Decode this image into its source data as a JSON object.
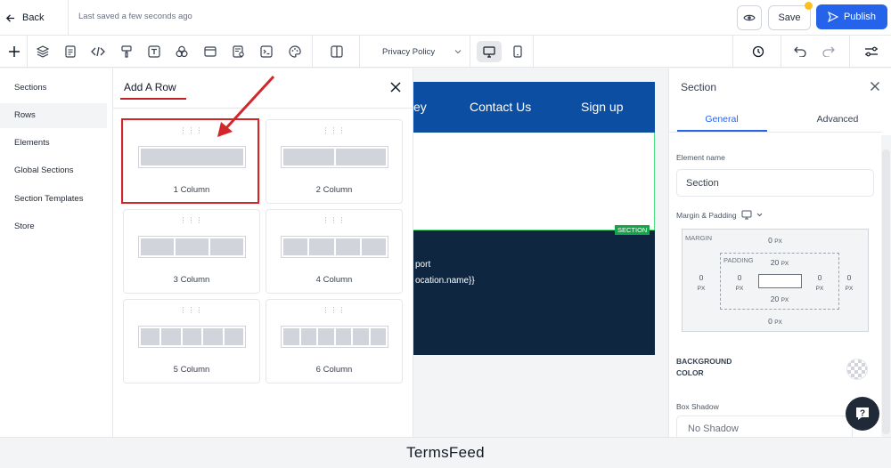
{
  "header": {
    "back_label": "Back",
    "saved_status": "Last saved a few seconds ago",
    "save_label": "Save",
    "publish_label": "Publish"
  },
  "toolbar": {
    "page_selector": "Privacy Policy",
    "tools": [
      "add-icon",
      "layers-icon",
      "page-icon",
      "code-icon",
      "paint-icon",
      "text-icon",
      "shapes-icon",
      "window-icon",
      "form-icon",
      "terminal-icon",
      "palette-icon",
      "columns-icon"
    ],
    "right_tools": [
      "history-icon",
      "undo-icon",
      "redo-icon",
      "settings-sliders-icon"
    ]
  },
  "left_nav": {
    "items": [
      {
        "label": "Sections"
      },
      {
        "label": "Rows",
        "active": true
      },
      {
        "label": "Elements"
      },
      {
        "label": "Global Sections"
      },
      {
        "label": "Section Templates"
      },
      {
        "label": "Store"
      }
    ]
  },
  "add_row_panel": {
    "title": "Add A Row",
    "options": [
      {
        "label": "1 Column",
        "columns": 1
      },
      {
        "label": "2 Column",
        "columns": 2
      },
      {
        "label": "3 Column",
        "columns": 3
      },
      {
        "label": "4 Column",
        "columns": 4
      },
      {
        "label": "5 Column",
        "columns": 5
      },
      {
        "label": "6 Column",
        "columns": 6
      }
    ]
  },
  "canvas": {
    "nav_links": [
      "ey",
      "Contact Us",
      "Sign up"
    ],
    "section_badge": "SECTION",
    "dark_text_1": "port",
    "dark_text_2": "ocation.name}}"
  },
  "right_panel": {
    "title": "Section",
    "tabs": [
      "General",
      "Advanced"
    ],
    "active_tab": "General",
    "element_name_label": "Element name",
    "element_name_value": "Section",
    "margin_padding_label": "Margin & Padding",
    "margin_label": "MARGIN",
    "padding_label": "PADDING",
    "unit": "PX",
    "margin": {
      "top": "0",
      "right": "0",
      "bottom": "0",
      "left": "0"
    },
    "padding": {
      "top": "20",
      "right": "0",
      "bottom": "20",
      "left": "0"
    },
    "background_color_label": "BACKGROUND COLOR",
    "box_shadow_label": "Box Shadow",
    "box_shadow_value": "No Shadow"
  },
  "footer": {
    "text": "TermsFeed"
  },
  "colors": {
    "accent": "#2563eb",
    "nav_band": "#0c4ea2",
    "dark_section": "#0f2640",
    "highlight": "#d3262b",
    "badge": "#16a34a"
  }
}
